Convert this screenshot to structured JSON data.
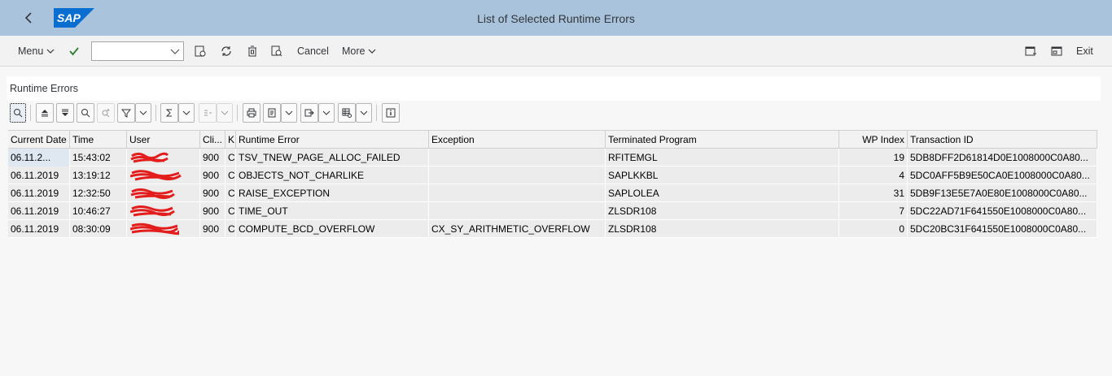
{
  "shell": {
    "title": "List of Selected Runtime Errors",
    "logo_text": "SAP",
    "brand_color": "#0a6ed1"
  },
  "toolbar": {
    "menu_label": "Menu",
    "command_placeholder": "",
    "cancel_label": "Cancel",
    "more_label": "More",
    "exit_label": "Exit"
  },
  "panel": {
    "title": "Runtime Errors"
  },
  "grid": {
    "columns": [
      "Current Date",
      "Time",
      "User",
      "Cli...",
      "K",
      "Runtime Error",
      "Exception",
      "Terminated Program",
      "WP Index",
      "Transaction ID"
    ],
    "rows": [
      {
        "date": "06.11.2...",
        "time": "15:43:02",
        "client": "900",
        "k": "C",
        "error": "TSV_TNEW_PAGE_ALLOC_FAILED",
        "exception": "",
        "program": "RFITEMGL",
        "wp": "19",
        "txid": "5DB8DFF2D61814D0E1008000C0A80..."
      },
      {
        "date": "06.11.2019",
        "time": "13:19:12",
        "client": "900",
        "k": "C",
        "error": "OBJECTS_NOT_CHARLIKE",
        "exception": "",
        "program": "SAPLKKBL",
        "wp": "4",
        "txid": "5DC0AFF5B9E50CA0E1008000C0A80..."
      },
      {
        "date": "06.11.2019",
        "time": "12:32:50",
        "client": "900",
        "k": "C",
        "error": "RAISE_EXCEPTION",
        "exception": "",
        "program": "SAPLOLEA",
        "wp": "31",
        "txid": "5DB9F13E5E7A0E80E1008000C0A80..."
      },
      {
        "date": "06.11.2019",
        "time": "10:46:27",
        "client": "900",
        "k": "C",
        "error": "TIME_OUT",
        "exception": "",
        "program": "ZLSDR108",
        "wp": "7",
        "txid": "5DC22AD71F641550E1008000C0A80..."
      },
      {
        "date": "06.11.2019",
        "time": "08:30:09",
        "client": "900",
        "k": "C",
        "error": "COMPUTE_BCD_OVERFLOW",
        "exception": "CX_SY_ARITHMETIC_OVERFLOW",
        "program": "ZLSDR108",
        "wp": "0",
        "txid": "5DC20BC31F641550E1008000C0A80..."
      }
    ]
  }
}
